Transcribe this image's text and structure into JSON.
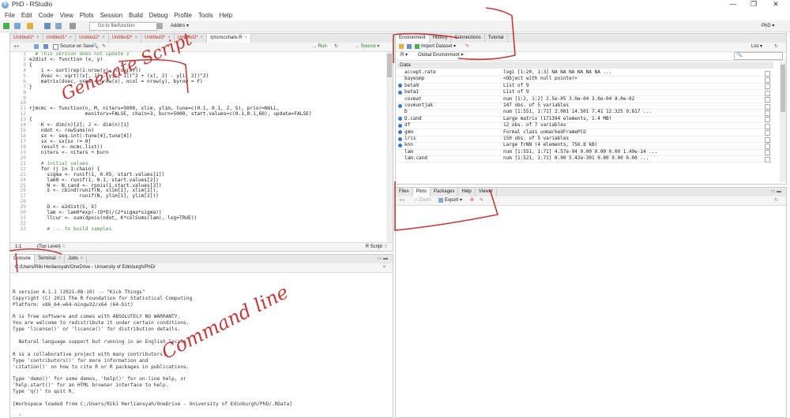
{
  "window": {
    "title": "PhD - RStudio",
    "minimize": "—",
    "restore": "❐",
    "close": "✕"
  },
  "menu": [
    "File",
    "Edit",
    "Code",
    "View",
    "Plots",
    "Session",
    "Build",
    "Debug",
    "Profile",
    "Tools",
    "Help"
  ],
  "toolbar": {
    "goto_placeholder": "Go to file/function",
    "addins": "Addins ▾",
    "project": "PhD ▾"
  },
  "editor": {
    "tabs": [
      {
        "label": "Untitled1*"
      },
      {
        "label": "Untitled1*"
      },
      {
        "label": "Untitled2*"
      },
      {
        "label": "Untitled2*"
      },
      {
        "label": "Untitled3*"
      },
      {
        "label": "Untitled3*"
      },
      {
        "label": "rjmcmcshare.R",
        "active": true
      }
    ],
    "source_on_save": "Source on Save",
    "run": "→ Run",
    "source": "→ Source ▾",
    "lines": [
      {
        "n": "1",
        "t": "  # This version does not update z"
      },
      {
        "n": "2",
        "t": "e2dist <- function (x, y)"
      },
      {
        "n": "3",
        "t": "{"
      },
      {
        "n": "4",
        "t": "    i <- sort(rep(1:nrow(y), nrow(x)))"
      },
      {
        "n": "5",
        "t": "    dvec <- sqrt((x[, 1] - y[i, 1])^2 + (x[, 2] - y[i, 2])^2)"
      },
      {
        "n": "6",
        "t": "    matrix(dvec, nrow = nrow(x), ncol = nrow(y), byrow = F)"
      },
      {
        "n": "7",
        "t": "}"
      },
      {
        "n": "8",
        "t": ""
      },
      {
        "n": "9",
        "t": ""
      },
      {
        "n": "10",
        "t": ""
      },
      {
        "n": "11",
        "t": "rjmcmc <- function(n, M, niters=5000, xlim, ylim, tune=c(0.1, 0.1, 2, 5), prior=NULL,"
      },
      {
        "n": "12",
        "t": "                   monitors=FALSE, chain=3, burn=5000, start.values=c(0.1,0.1,60), update=FALSE)"
      },
      {
        "n": "13",
        "t": "{"
      },
      {
        "n": "14",
        "t": "    K <- dim(n)[2]; J <- dim(n)[1]"
      },
      {
        "n": "15",
        "t": "    ndot <- rowSums(n)"
      },
      {
        "n": "16",
        "t": "    sx <- seq.int(-tune[4],tune[4])"
      },
      {
        "n": "17",
        "t": "    sx <- sx[sx != 0]"
      },
      {
        "n": "18",
        "t": "    result <- mcmc.list()"
      },
      {
        "n": "19",
        "t": "    niters <- niters + burn"
      },
      {
        "n": "20",
        "t": ""
      },
      {
        "n": "21",
        "t": "    # initial values"
      },
      {
        "n": "22",
        "t": "    for (j in 1:chain) {"
      },
      {
        "n": "23",
        "t": "      sigma <- runif(1, 0.05, start.values[1])"
      },
      {
        "n": "24",
        "t": "      lam0 <- runif(1, 0.1, start.values[2])"
      },
      {
        "n": "25",
        "t": "      N <- N.cand <- rpois(1,start.values[3])"
      },
      {
        "n": "26",
        "t": "      S <- cbind(runif(N, xlim[1], xlim[2]),"
      },
      {
        "n": "27",
        "t": "                 runif(N, ylim[1], ylim[2]))"
      },
      {
        "n": "28",
        "t": ""
      },
      {
        "n": "29",
        "t": "      D <- e2dist(S, X)"
      },
      {
        "n": "30",
        "t": "      lam <- lam0*exp(-(D*D)/(2*sigma*sigma))"
      },
      {
        "n": "31",
        "t": "      llcur <- sum(dpois(ndot, K*colSums(lam), log=TRUE))"
      },
      {
        "n": "32",
        "t": ""
      },
      {
        "n": "33",
        "t": "      # ... to build samples"
      }
    ],
    "status_pos": "1:1",
    "status_scope": "(Top Level) ♢",
    "status_type": "R Script ♢"
  },
  "console": {
    "tabs": [
      {
        "label": "Console",
        "active": true
      },
      {
        "label": "Terminal"
      },
      {
        "label": "Jobs"
      }
    ],
    "path": "C:/Users/Riki Herliansyah/OneDrive - University of Edinburgh/PhD/",
    "lines": [
      "",
      "R version 4.1.1 (2021-08-10) -- \"Kick Things\"",
      "Copyright (C) 2021 The R Foundation for Statistical Computing",
      "Platform: x86_64-w64-mingw32/x64 (64-bit)",
      "",
      "R is free software and comes with ABSOLUTELY NO WARRANTY.",
      "You are welcome to redistribute it under certain conditions.",
      "Type 'license()' or 'licence()' for distribution details.",
      "",
      "  Natural language support but running in an English locale",
      "",
      "R is a collaborative project with many contributors.",
      "Type 'contributors()' for more information and",
      "'citation()' on how to cite R or R packages in publications.",
      "",
      "Type 'demo()' for some demos, 'help()' for on-line help, or",
      "'help.start()' for an HTML browser interface to help.",
      "Type 'q()' to quit R.",
      "",
      "[Workspace loaded from C:/Users/Riki Herliansyah/OneDrive - University of Edinburgh/PhD/.RData]",
      "",
      "> |"
    ]
  },
  "environment": {
    "tabs": [
      {
        "label": "Environment",
        "active": true
      },
      {
        "label": "History"
      },
      {
        "label": "Connections"
      },
      {
        "label": "Tutorial"
      }
    ],
    "import_dataset": "Import Dataset ▾",
    "r_selector": "R ▾",
    "scope": "Global Environment ▾",
    "list_view": "List ▾",
    "section": "Data",
    "rows": [
      {
        "name": "accept.rate",
        "value": "logi [1:20, 1:3] NA NA NA NA NA NA ...",
        "expand": false
      },
      {
        "name": "bayesmp",
        "value": "<Object with null pointer>",
        "expand": false
      },
      {
        "name": "beta0",
        "value": "List of  9",
        "expand": true
      },
      {
        "name": "beta1",
        "value": "List of  9",
        "expand": true
      },
      {
        "name": "covmat",
        "value": "num [1:2, 1:2] 2.5e-05 3.0e-04 3.0e-04 9.0e-02",
        "expand": false
      },
      {
        "name": "covmuntjak",
        "value": "147 obs. of 5 variables",
        "expand": true
      },
      {
        "name": "D",
        "value": "num [1:551, 1:71] 2.081 14.501 7.41 12.325 0.817 ...",
        "expand": false
      },
      {
        "name": "D.cand",
        "value": "Large matrix (171394 elements,  1.4 MB)",
        "expand": true
      },
      {
        "name": "df",
        "value": "12 obs. of 7 variables",
        "expand": true
      },
      {
        "name": "gmm",
        "value": "Formal class  unmarkedFramePCO",
        "expand": true
      },
      {
        "name": "iris",
        "value": "150 obs. of 5 variables",
        "expand": true
      },
      {
        "name": "knn",
        "value": "Large frNN (4 elements,  756.8 kB)",
        "expand": true
      },
      {
        "name": "lam",
        "value": "num [1:551, 1:71] 4.57e-94 0.00 0.00 0.00 1.49e-14 ...",
        "expand": false
      },
      {
        "name": "lam.cand",
        "value": "num [1:521, 1:71] 0.00 5.42e-301 0.00 0.00 0.00 ...",
        "expand": false
      }
    ]
  },
  "files": {
    "tabs": [
      {
        "label": "Files"
      },
      {
        "label": "Plots",
        "active": true
      },
      {
        "label": "Packages"
      },
      {
        "label": "Help"
      },
      {
        "label": "Viewer"
      }
    ],
    "zoom": "Zoom",
    "export": "Export ▾"
  },
  "annotations": {
    "script": "Generate Script",
    "command": "Command line"
  },
  "colors": {
    "annotation": "#c23a3a",
    "accent": "#75aadb",
    "tab_modified": "#b33333"
  }
}
